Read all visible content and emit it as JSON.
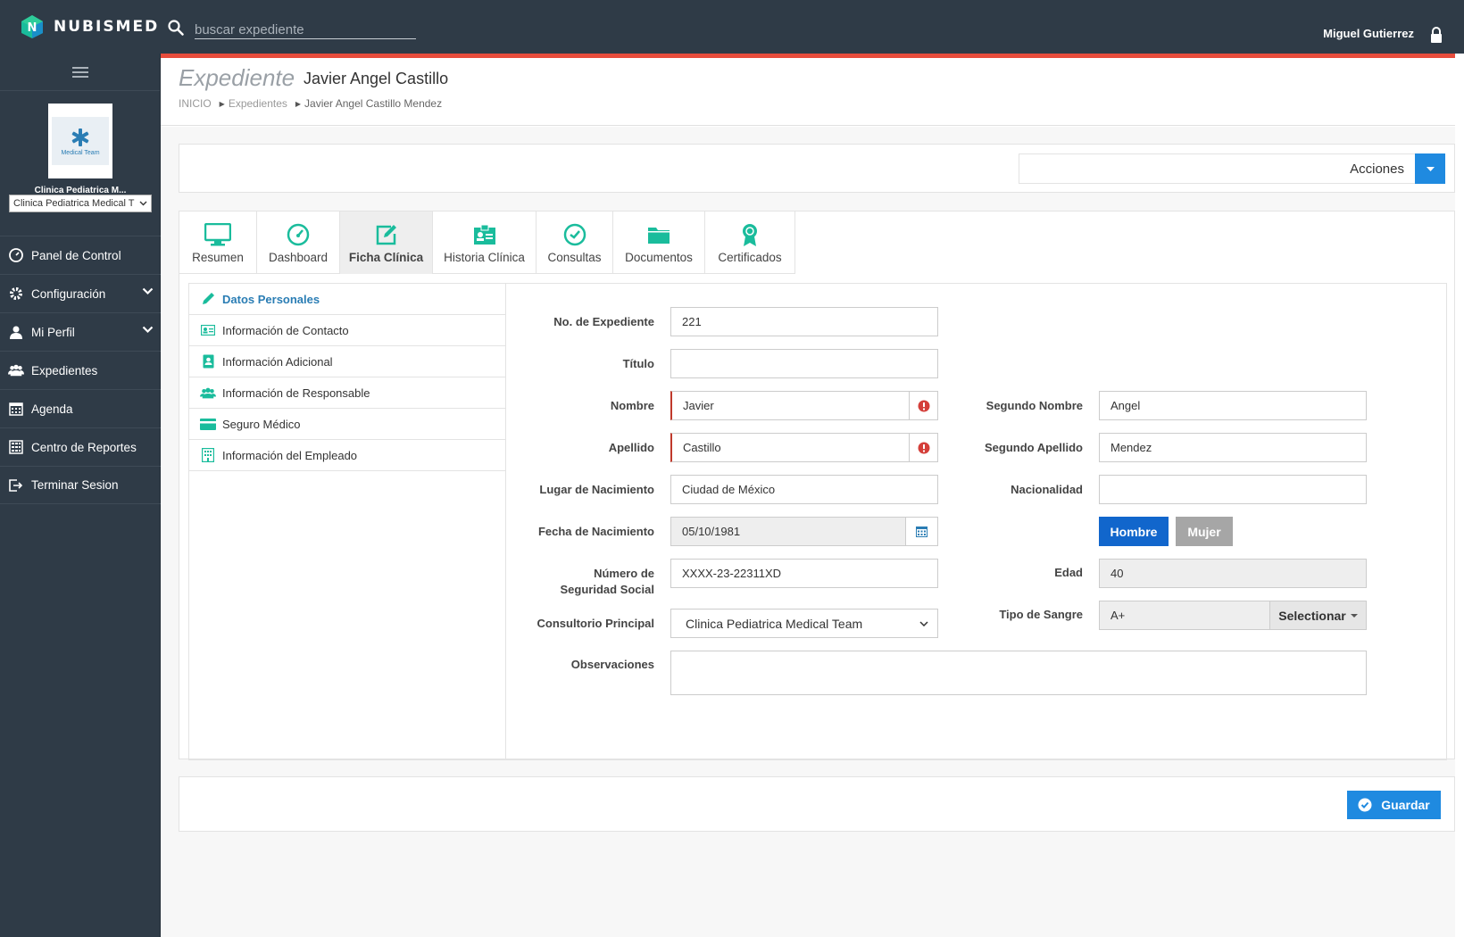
{
  "app": {
    "name": "NUBISMED"
  },
  "search": {
    "placeholder": "buscar expediente"
  },
  "user": {
    "name": "Miguel Gutierrez"
  },
  "clinic": {
    "logo_text": "Medical Team",
    "name": "Clinica Pediatrica M...",
    "select_value": "Clinica Pediatrica Medical T"
  },
  "sidebar": {
    "items": [
      {
        "label": "Panel de Control",
        "icon": "dashboard-icon"
      },
      {
        "label": "Configuración",
        "icon": "gear-icon"
      },
      {
        "label": "Mi Perfil",
        "icon": "user-icon"
      },
      {
        "label": "Expedientes",
        "icon": "users-icon"
      },
      {
        "label": "Agenda",
        "icon": "calendar-icon"
      },
      {
        "label": "Centro de Reportes",
        "icon": "report-icon"
      },
      {
        "label": "Terminar Sesion",
        "icon": "logout-icon"
      }
    ]
  },
  "header": {
    "section": "Expediente",
    "patient": "Javier Angel Castillo",
    "breadcrumb": [
      "INICIO",
      "Expedientes",
      "Javier Angel Castillo Mendez"
    ]
  },
  "actions": {
    "label": "Acciones"
  },
  "tabs": [
    {
      "label": "Resumen"
    },
    {
      "label": "Dashboard"
    },
    {
      "label": "Ficha Clínica"
    },
    {
      "label": "Historia Clínica"
    },
    {
      "label": "Consultas"
    },
    {
      "label": "Documentos"
    },
    {
      "label": "Certificados"
    }
  ],
  "subnav": [
    {
      "label": "Datos Personales"
    },
    {
      "label": "Información de Contacto"
    },
    {
      "label": "Información Adicional"
    },
    {
      "label": "Información de Responsable"
    },
    {
      "label": "Seguro Médico"
    },
    {
      "label": "Información del Empleado"
    }
  ],
  "form": {
    "expediente": {
      "label": "No. de Expediente",
      "value": "221"
    },
    "titulo": {
      "label": "Título",
      "value": ""
    },
    "nombre": {
      "label": "Nombre",
      "value": "Javier"
    },
    "segundo_nombre": {
      "label": "Segundo Nombre",
      "value": "Angel"
    },
    "apellido": {
      "label": "Apellido",
      "value": "Castillo"
    },
    "segundo_apellido": {
      "label": "Segundo Apellido",
      "value": "Mendez"
    },
    "lugar_nacimiento": {
      "label": "Lugar de Nacimiento",
      "value": "Ciudad de México"
    },
    "nacionalidad": {
      "label": "Nacionalidad",
      "value": ""
    },
    "fecha_nacimiento": {
      "label": "Fecha de Nacimiento",
      "value": "05/10/1981"
    },
    "genero": {
      "hombre": "Hombre",
      "mujer": "Mujer",
      "selected": "Hombre"
    },
    "nss": {
      "label_line1": "Número de",
      "label_line2": "Seguridad Social",
      "value": "XXXX-23-22311XD"
    },
    "edad": {
      "label": "Edad",
      "value": "40"
    },
    "consultorio": {
      "label": "Consultorio Principal",
      "value": "Clinica Pediatrica Medical Team"
    },
    "sangre": {
      "label": "Tipo de Sangre",
      "value": "A+",
      "button": "Selectionar"
    },
    "observaciones": {
      "label": "Observaciones",
      "value": ""
    }
  },
  "footer": {
    "save_label": "Guardar"
  },
  "colors": {
    "topbar": "#2f3b47",
    "accent_red": "#e74c3c",
    "primary": "#1f8ae0",
    "teal": "#1abc9c"
  }
}
